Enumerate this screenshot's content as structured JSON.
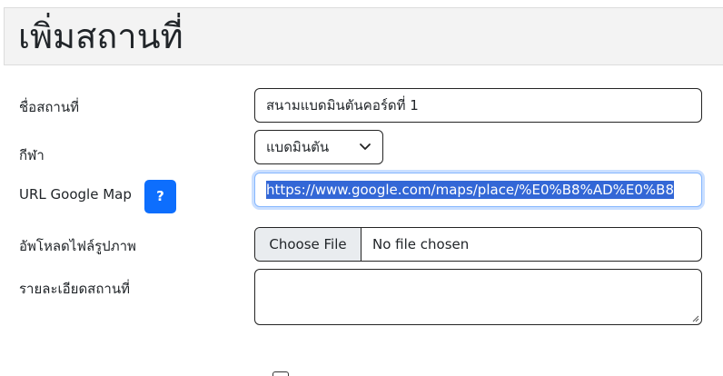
{
  "header": {
    "title": "เพิ่มสถานที่"
  },
  "form": {
    "name": {
      "label": "ชื่อสถานที่",
      "value": "สนามแบดมินตันคอร์ดที่ 1"
    },
    "sport": {
      "label": "กีฬา",
      "selected": "แบดมินตัน"
    },
    "map_url": {
      "label": "URL Google Map",
      "help_label": "?",
      "value": "https://www.google.com/maps/place/%E0%B8%AD%E0%B8"
    },
    "image_upload": {
      "label": "อัพโหลดไฟล์รูปภาพ",
      "button_label": "Choose File",
      "status": "No file chosen"
    },
    "description": {
      "label": "รายละเอียดสถานที่",
      "value": ""
    }
  },
  "colors": {
    "primary": "#0d6efd",
    "selection": "#3367d6",
    "header_bg": "#f3f3f3"
  },
  "icons": {
    "select_arrow": "chevron-down-icon",
    "textarea_grip": "resize-grip-icon"
  }
}
